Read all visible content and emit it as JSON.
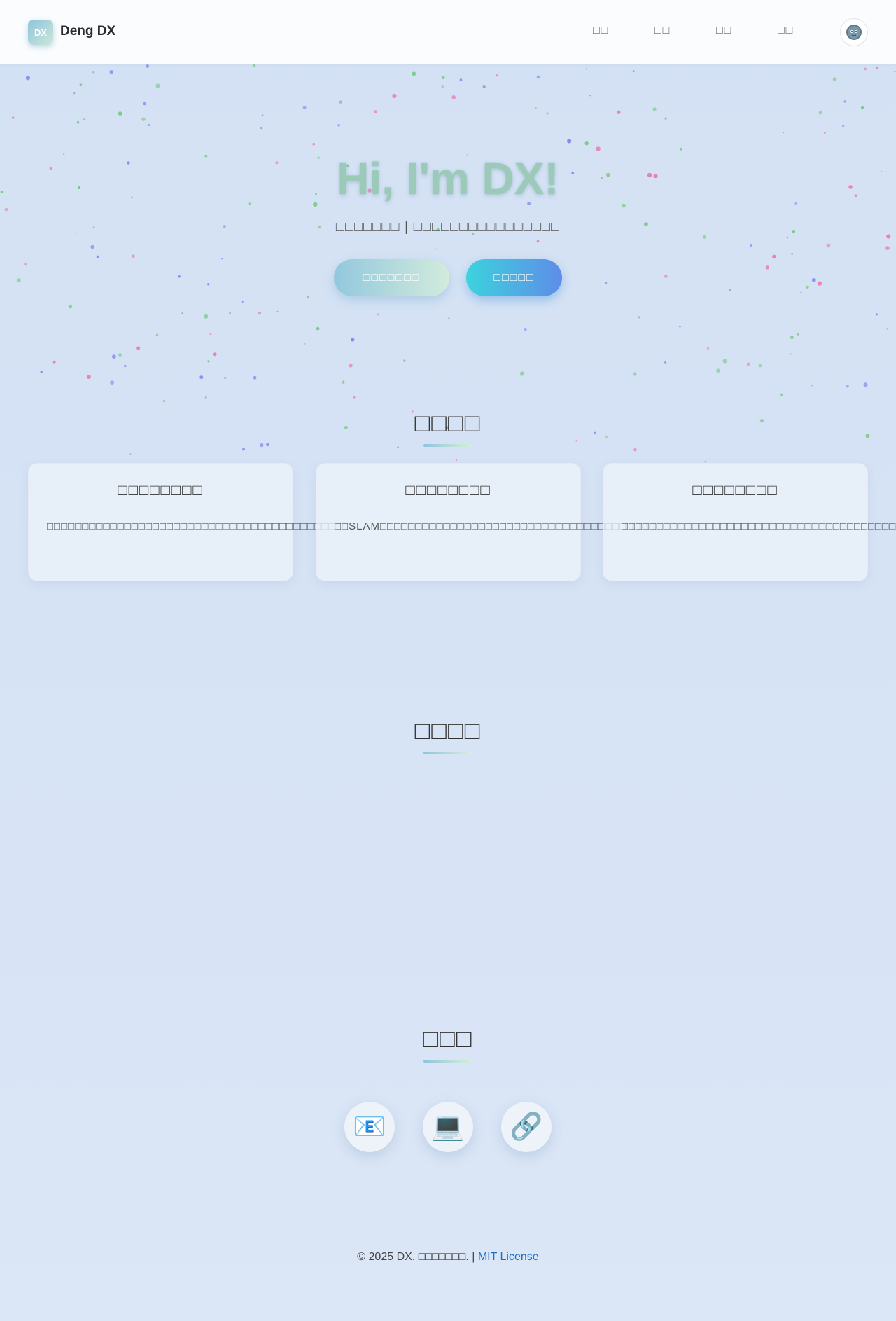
{
  "header": {
    "logo_badge": "DX",
    "logo_name": "Deng DX",
    "nav": [
      "□□",
      "□□",
      "□□",
      "□□"
    ],
    "theme_icon": "avatar-theme-icon"
  },
  "hero": {
    "title": "Hi, I'm DX!",
    "subtitle": "□□□□□□□ | □□□□□□□□□□□□□□□□",
    "primary_button": "□□□□□□□",
    "secondary_button": "□□□□□"
  },
  "skills": {
    "title": "□□□□",
    "cards": [
      {
        "title": "□□□□□□□□",
        "desc": "□□□□□□□□□□□□□□□□□□□□□□□□□□□□□□□□□□□□□□□□□□□"
      },
      {
        "title": "□□□□□□□□",
        "desc": "□□SLAM□□□□□□□□□□□□□□□□□□□□□□□□□□□□□□□□□□□□□□□"
      },
      {
        "title": "□□□□□□□□",
        "desc": "□□□□□□□□□□□□□□□□□□□□□□□□□□□□□□□□□□□□□□□"
      }
    ]
  },
  "projects": {
    "title": "□□□□"
  },
  "contact": {
    "title": "□□□",
    "items": [
      {
        "icon": "email-icon",
        "glyph": "📧"
      },
      {
        "icon": "laptop-icon",
        "glyph": "💻"
      },
      {
        "icon": "link-icon",
        "glyph": "🔗"
      }
    ]
  },
  "footer": {
    "text": "© 2025 DX. □□□□□□□. | ",
    "license": "MIT License"
  },
  "colors": {
    "accent_gradient_start": "#8ec5dc",
    "accent_gradient_end": "#d2ebdc",
    "secondary_gradient_start": "#3cd3de",
    "secondary_gradient_end": "#5e8de8",
    "hero_title": "#9ccab8",
    "link": "#1a6fc6"
  }
}
